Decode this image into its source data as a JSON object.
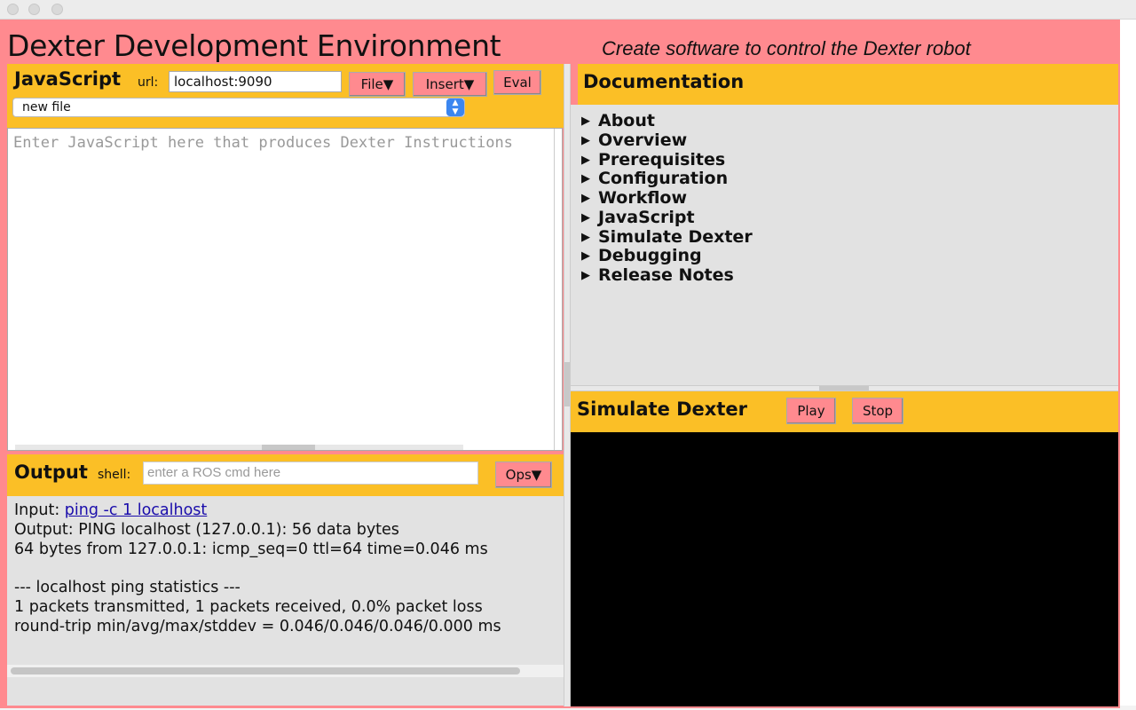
{
  "app": {
    "title": "Dexter Development Environment",
    "tagline": "Create software to control the Dexter robot",
    "frame_color": "#ff8a8f",
    "panel_color": "#fbbf26"
  },
  "javascript": {
    "title": "JavaScript",
    "url_label": "url:",
    "url_value": "localhost:9090",
    "file_label": "File▼",
    "insert_label": "Insert▼",
    "eval_label": "Eval",
    "file_select_value": "new file",
    "editor_placeholder": "Enter JavaScript here that produces Dexter Instructions"
  },
  "output": {
    "title": "Output",
    "shell_label": "shell:",
    "shell_placeholder": "enter a ROS cmd here",
    "ops_label": "Ops▼",
    "input_label": "Input:",
    "input_link": "ping -c 1 localhost",
    "lines": [
      "Output: PING localhost (127.0.0.1): 56 data bytes",
      "64 bytes from 127.0.0.1: icmp_seq=0 ttl=64 time=0.046 ms",
      "",
      "--- localhost ping statistics ---",
      "1 packets transmitted, 1 packets received, 0.0% packet loss",
      "round-trip min/avg/max/stddev = 0.046/0.046/0.046/0.000 ms"
    ]
  },
  "documentation": {
    "title": "Documentation",
    "items": [
      {
        "label": "About"
      },
      {
        "label": "Overview"
      },
      {
        "label": "Prerequisites"
      },
      {
        "label": "Configuration"
      },
      {
        "label": "Workflow"
      },
      {
        "label": "JavaScript"
      },
      {
        "label": "Simulate Dexter"
      },
      {
        "label": "Debugging"
      },
      {
        "label": "Release Notes"
      }
    ],
    "item_icon": "triangle-right-icon"
  },
  "simulate": {
    "title": "Simulate Dexter",
    "play_label": "Play",
    "stop_label": "Stop"
  }
}
